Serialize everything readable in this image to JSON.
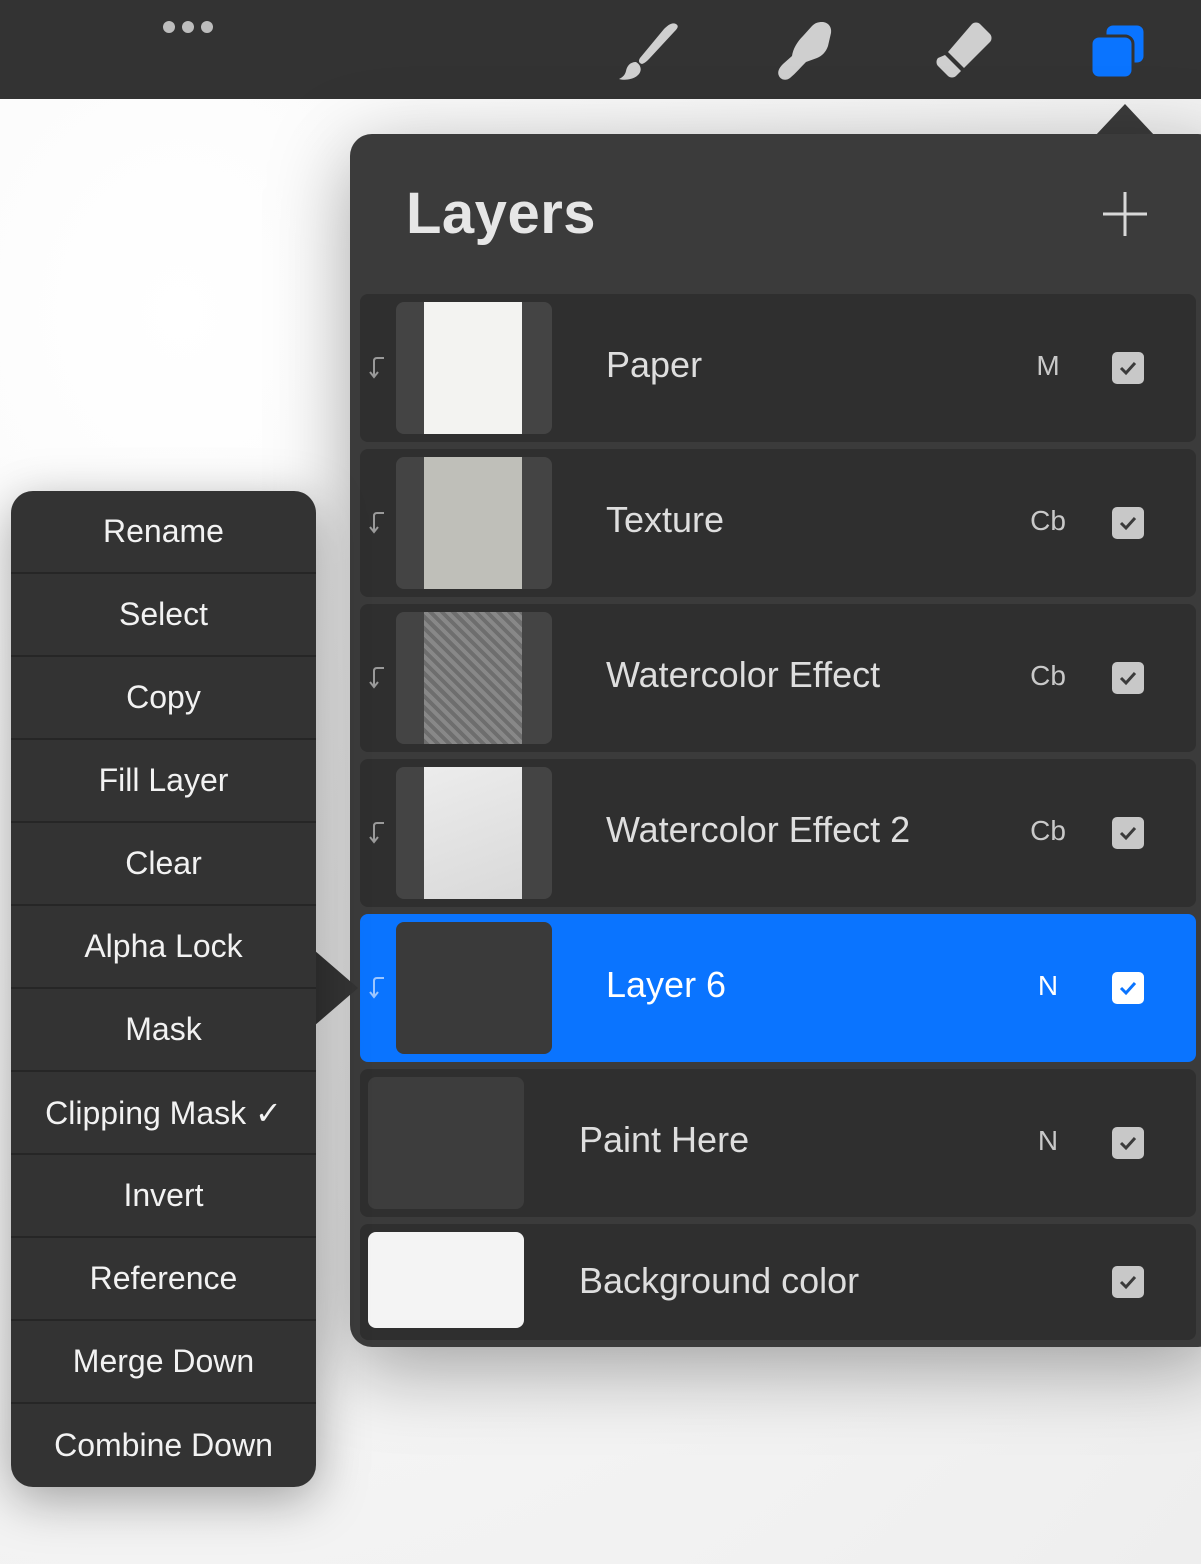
{
  "colors": {
    "toolbar_bg": "#333333",
    "panel_bg": "#3b3b3b",
    "row_bg": "#2f2f2f",
    "accent": "#0a74ff",
    "menu_bg": "#333333"
  },
  "toolbar": {
    "more_icon": "ellipsis-icon",
    "tools": [
      {
        "name": "brush",
        "icon": "paintbrush-icon",
        "active": false
      },
      {
        "name": "smudge",
        "icon": "smudge-finger-icon",
        "active": false
      },
      {
        "name": "eraser",
        "icon": "eraser-icon",
        "active": false
      },
      {
        "name": "layers",
        "icon": "layers-icon",
        "active": true
      }
    ]
  },
  "layers_panel": {
    "title": "Layers",
    "add_icon": "plus-icon",
    "layers": [
      {
        "name": "Paper",
        "blend_mode": "M",
        "visible": true,
        "clipping": true,
        "selected": false
      },
      {
        "name": "Texture",
        "blend_mode": "Cb",
        "visible": true,
        "clipping": true,
        "selected": false
      },
      {
        "name": "Watercolor Effect",
        "blend_mode": "Cb",
        "visible": true,
        "clipping": true,
        "selected": false
      },
      {
        "name": "Watercolor Effect 2",
        "blend_mode": "Cb",
        "visible": true,
        "clipping": true,
        "selected": false
      },
      {
        "name": "Layer 6",
        "blend_mode": "N",
        "visible": true,
        "clipping": true,
        "selected": true
      },
      {
        "name": "Paint Here",
        "blend_mode": "N",
        "visible": true,
        "clipping": false,
        "selected": false
      },
      {
        "name": "Background color",
        "blend_mode": "",
        "visible": true,
        "clipping": false,
        "selected": false
      }
    ]
  },
  "layer_menu": {
    "items": [
      "Rename",
      "Select",
      "Copy",
      "Fill Layer",
      "Clear",
      "Alpha Lock",
      "Mask",
      "Clipping Mask ✓",
      "Invert",
      "Reference",
      "Merge Down",
      "Combine Down"
    ]
  }
}
